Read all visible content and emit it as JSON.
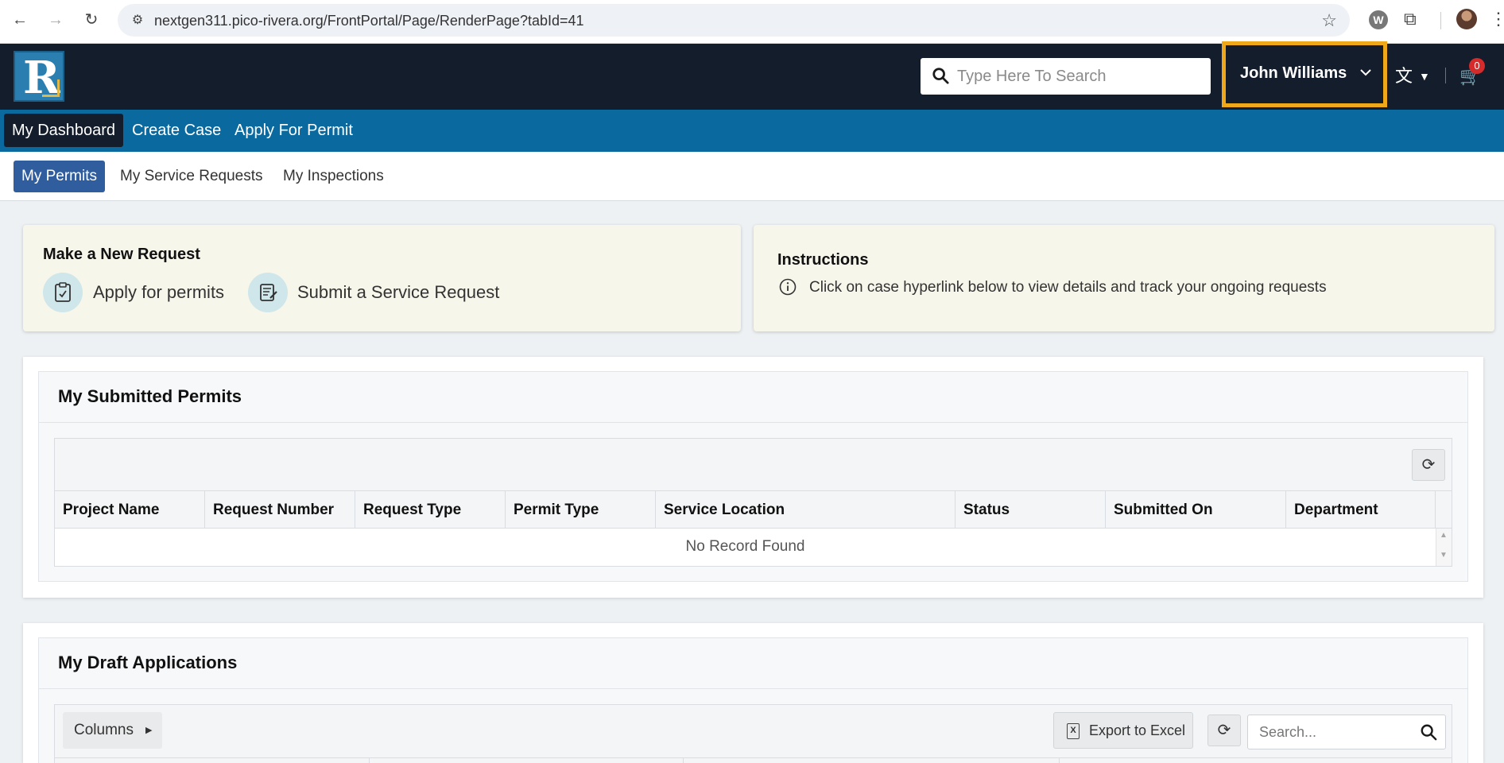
{
  "browser": {
    "url": "nextgen311.pico-rivera.org/FrontPortal/Page/RenderPage?tabId=41",
    "extension_letter": "W"
  },
  "header": {
    "logo_letter": "R",
    "search_placeholder": "Type Here To Search",
    "user_name": "John Williams",
    "cart_count": "0"
  },
  "main_nav": {
    "items": [
      "My Dashboard",
      "Create Case",
      "Apply For Permit"
    ],
    "active": "My Dashboard"
  },
  "sub_nav": {
    "items": [
      "My Permits",
      "My Service Requests",
      "My Inspections"
    ],
    "active": "My Permits"
  },
  "new_request": {
    "title": "Make a New Request",
    "apply_label": "Apply for permits",
    "service_label": "Submit a Service Request"
  },
  "instructions": {
    "title": "Instructions",
    "text": "Click on case hyperlink below to view details and track your ongoing requests"
  },
  "submitted_permits": {
    "title": "My Submitted Permits",
    "columns": [
      "Project Name",
      "Request Number",
      "Request Type",
      "Permit Type",
      "Service Location",
      "Status",
      "Submitted On",
      "Department"
    ],
    "empty_message": "No Record Found"
  },
  "draft_applications": {
    "title": "My Draft Applications",
    "columns_label": "Columns",
    "export_label": "Export to Excel",
    "search_placeholder": "Search..."
  },
  "colors": {
    "header_bg": "#141d2b",
    "nav_bg": "#0a6aa0",
    "active_tab": "#2f5d9e",
    "highlight": "#f0a81b",
    "card_bg": "#f7f6eb",
    "badge": "#d52b2b"
  }
}
